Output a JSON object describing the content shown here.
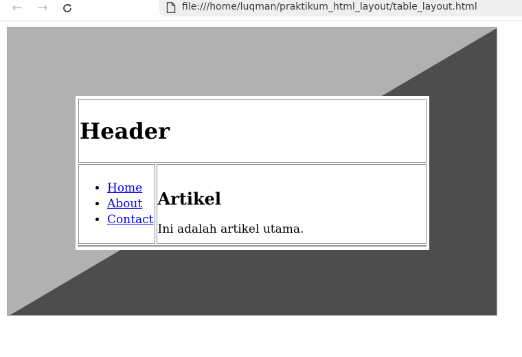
{
  "browser": {
    "back_icon": "arrow-left-icon",
    "forward_icon": "arrow-right-icon",
    "reload_icon": "reload-icon",
    "page_icon": "file-icon",
    "url": "file:///home/luqman/praktikum_html_layout/table_layout.html"
  },
  "page": {
    "header": "Header",
    "nav_links": [
      "Home",
      "About",
      "Contact"
    ],
    "article_title": "Artikel",
    "article_text": "Ini adalah artikel utama.",
    "colors": {
      "light_triangle": "#b1b1b1",
      "dark_triangle": "#4d4d4d",
      "link": "#0000ee"
    }
  }
}
